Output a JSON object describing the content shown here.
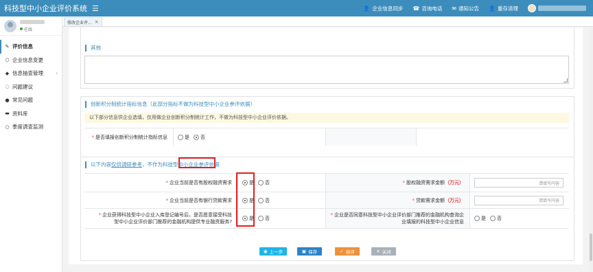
{
  "header": {
    "app_title": "科技型中小企业评价系统",
    "menu_icon": "hamburger-icon",
    "actions": [
      {
        "icon": "user-icon",
        "label": "企业信息同步"
      },
      {
        "icon": "phone-icon",
        "label": "咨询电话"
      },
      {
        "icon": "mail-icon",
        "label": "通知公告"
      },
      {
        "icon": "user-icon",
        "label": "重存清理"
      }
    ]
  },
  "sidebar": {
    "status": "在线",
    "items": [
      {
        "icon": "edit-icon",
        "label": "评价信息",
        "active": true
      },
      {
        "icon": "circle-icon",
        "label": "企业信息变更"
      },
      {
        "icon": "tag-icon",
        "label": "信息抽查管理",
        "has_children": true
      },
      {
        "icon": "comment-icon",
        "label": "问题建议"
      },
      {
        "icon": "question-icon",
        "label": "常见问题"
      },
      {
        "icon": "folder-icon",
        "label": "资料库"
      },
      {
        "icon": "circle-icon",
        "label": "季度调查监测"
      }
    ]
  },
  "tabs": [
    {
      "label": "修改企业评...",
      "close": "×"
    }
  ],
  "form": {
    "other_section": {
      "title": "其他"
    },
    "innovation_section": {
      "title": "创新积分制统计指标信息（此部分指标不做为科技型中小企业参评依据）",
      "notice": "以下部分信息供企业选填，仅用做企业创新积分制统计工作，不做为科技型中小企业评价依据。",
      "question": "是否填报创新积分制统计指标信息",
      "yes": "是",
      "no": "否",
      "selected": "no"
    },
    "research_section": {
      "title_prefix": "以下内容",
      "title_highlight": "仅供调研参考",
      "title_suffix": "，不作为科技型中小企业参评依据",
      "rows": [
        {
          "question": "企业当前是否有股权融资需求",
          "yes": "是",
          "no": "否",
          "selected": "yes",
          "amount_label": "股权融资需求金额",
          "unit": "（万元）",
          "amount_placeholder": "请填写内容"
        },
        {
          "question": "企业当前是否有银行贷款需求",
          "yes": "是",
          "no": "否",
          "selected": "yes",
          "amount_label": "贷款需求金额",
          "unit": "（万元）",
          "amount_placeholder": "请填写内容"
        },
        {
          "question_line1": "企业获得科技型中小企业入库登记编号后，是否愿意接受科技",
          "question_line2": "型中小企业评价部门推荐的金融机构提供专业融资服务?",
          "yes": "是",
          "no": "否",
          "selected": "yes",
          "right_question_line1": "企业是否同意科技型中小企业评价部门推荐的金融机构查询企",
          "right_question_line2": "业填报的科技型中小企业信息",
          "right_yes": "是",
          "right_no": "否",
          "right_selected": "none"
        }
      ]
    }
  },
  "buttons": {
    "prev": "上一步",
    "save": "保存",
    "self_eval": "自评",
    "close": "关闭"
  },
  "colors": {
    "header_bg": "#3c8dbc",
    "highlight_border": "#e02020",
    "btn_prev": "#1fb5e8",
    "btn_save": "#2b83c8",
    "btn_self": "#f0913a",
    "btn_close": "#a8b0b8"
  }
}
